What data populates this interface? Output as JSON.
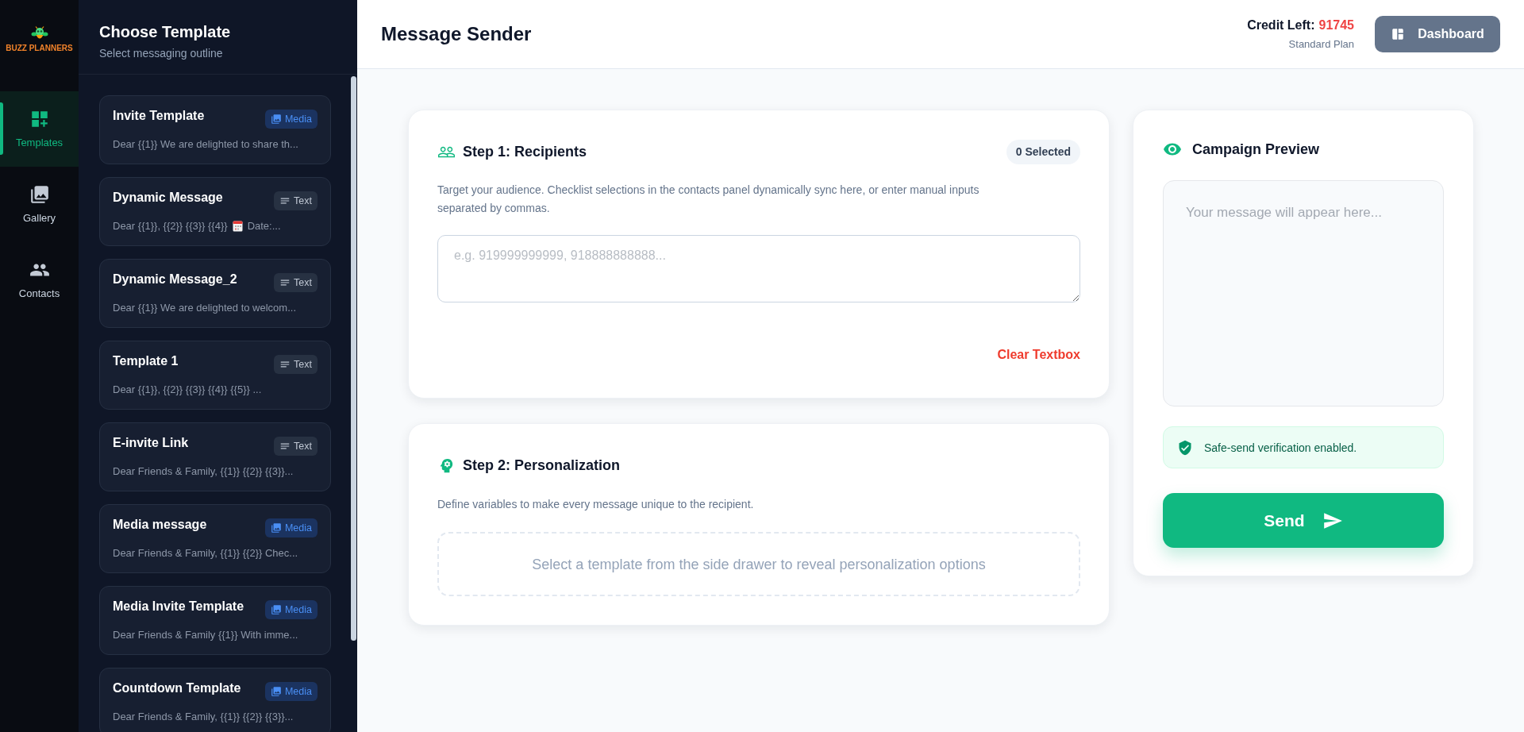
{
  "nav": {
    "logo": "BUZZ PLANNERS",
    "items": [
      {
        "kind": "templates",
        "label": "Templates",
        "selected": true
      },
      {
        "kind": "gallery",
        "label": "Gallery",
        "selected": false
      },
      {
        "kind": "contacts",
        "label": "Contacts",
        "selected": false
      }
    ]
  },
  "drawer": {
    "title": "Choose Template",
    "subtitle": "Select messaging outline",
    "templates": [
      {
        "name": "Invite Template",
        "kind": "media",
        "badge": "Media",
        "preview": [
          {
            "kind": "text",
            "text": "Dear {{1}} We are delighted to share th..."
          }
        ]
      },
      {
        "name": "Dynamic Message",
        "kind": "text",
        "badge": "Text",
        "preview": [
          {
            "kind": "text",
            "text": "Dear {{1}}, {{2}} {{3}} {{4}}"
          },
          {
            "kind": "calendar"
          },
          {
            "kind": "text",
            "text": "Date:..."
          }
        ]
      },
      {
        "name": "Dynamic Message_2",
        "kind": "text",
        "badge": "Text",
        "preview": [
          {
            "kind": "text",
            "text": "Dear {{1}} We are delighted to welcom..."
          }
        ]
      },
      {
        "name": "Template 1",
        "kind": "text",
        "badge": "Text",
        "preview": [
          {
            "kind": "text",
            "text": "Dear {{1}}, {{2}} {{3}} {{4}} {{5}} ..."
          }
        ]
      },
      {
        "name": "E-invite Link",
        "kind": "text",
        "badge": "Text",
        "preview": [
          {
            "kind": "text",
            "text": "Dear Friends & Family, {{1}} {{2}} {{3}}..."
          }
        ]
      },
      {
        "name": "Media message",
        "kind": "media",
        "badge": "Media",
        "preview": [
          {
            "kind": "text",
            "text": "Dear Friends & Family, {{1}} {{2}} Chec..."
          }
        ]
      },
      {
        "name": "Media Invite Template",
        "kind": "media",
        "badge": "Media",
        "preview": [
          {
            "kind": "text",
            "text": "Dear Friends & Family {{1}} With imme..."
          }
        ]
      },
      {
        "name": "Countdown Template",
        "kind": "media",
        "badge": "Media",
        "preview": [
          {
            "kind": "text",
            "text": "Dear Friends & Family, {{1}} {{2}} {{3}}..."
          }
        ]
      }
    ]
  },
  "header": {
    "title": "Message Sender",
    "credit_label": "Credit Left:",
    "credit_value": "91745",
    "plan": "Standard Plan",
    "dashboard_button": "Dashboard"
  },
  "recipients": {
    "title": "Step 1: Recipients",
    "selected_count": "0 Selected",
    "description": "Target your audience. Checklist selections in the contacts panel dynamically sync here, or enter manual inputs separated by commas.",
    "placeholder": "e.g. 919999999999, 918888888888...",
    "clear_button": "Clear Textbox"
  },
  "personalization": {
    "title": "Step 2: Personalization",
    "description": "Define variables to make every message unique to the recipient.",
    "empty_state": "Select a template from the side drawer to reveal personalization options"
  },
  "preview": {
    "title": "Campaign Preview",
    "placeholder": "Your message will appear here...",
    "safe_send": "Safe-send verification enabled.",
    "send_button": "Send"
  }
}
